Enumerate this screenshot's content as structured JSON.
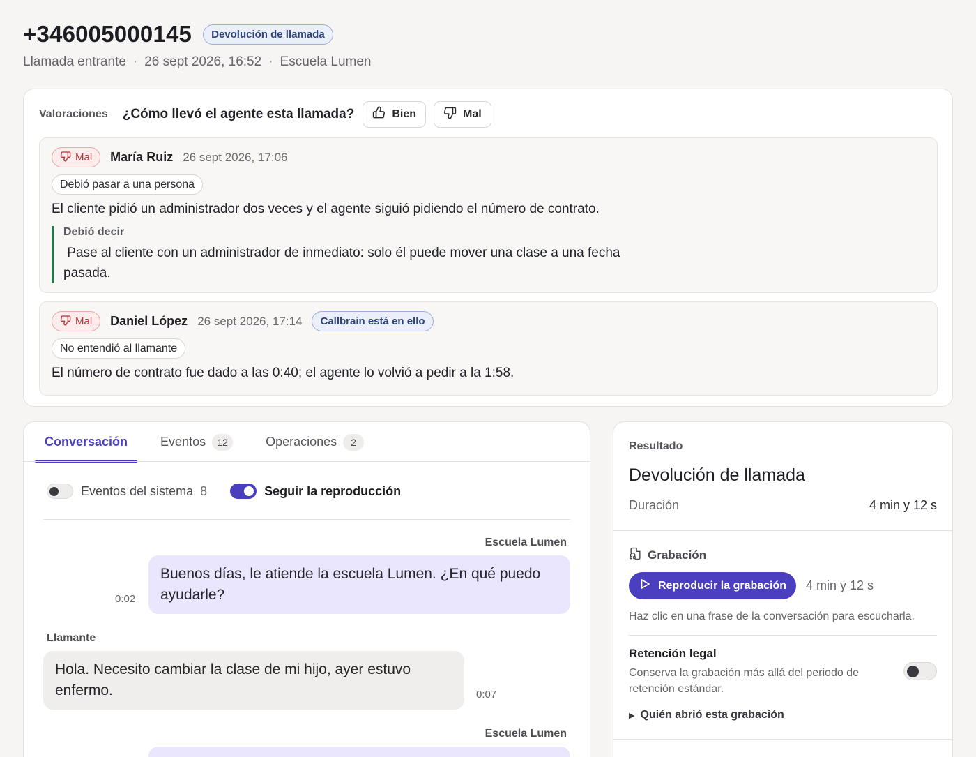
{
  "header": {
    "phone": "+346005000145",
    "badge": "Devolución de llamada",
    "meta": [
      "Llamada entrante",
      "26 sept 2026, 16:52",
      "Escuela Lumen"
    ],
    "separator": "·"
  },
  "ratings": {
    "label": "Valoraciones",
    "question": "¿Cómo llevó el agente esta llamada?",
    "good_label": "Bien",
    "bad_label": "Mal",
    "items": [
      {
        "verdict": "Mal",
        "author": "María Ruiz",
        "date": "26 sept 2026, 17:06",
        "tag": "Debió pasar a una persona",
        "comment": "El cliente pidió un administrador dos veces y el agente siguió pidiendo el número de contrato.",
        "should_say_label": "Debió decir",
        "should_say": " Pase al cliente con un administrador de inmediato: solo él puede mover una clase a una fecha pasada."
      },
      {
        "verdict": "Mal",
        "author": "Daniel López",
        "date": "26 sept 2026, 17:14",
        "status": "Callbrain está en ello",
        "tag": "No entendió al llamante",
        "comment": "El número de contrato fue dado a las 0:40; el agente lo volvió a pedir a la 1:58."
      }
    ]
  },
  "conversation": {
    "tabs": [
      {
        "label": "Conversación",
        "count": ""
      },
      {
        "label": "Eventos",
        "count": "12"
      },
      {
        "label": "Operaciones",
        "count": "2"
      }
    ],
    "system_events_label": "Eventos del sistema",
    "system_events_count": "8",
    "system_events_enabled": false,
    "follow_playback_label": "Seguir la reproducción",
    "follow_playback_enabled": true,
    "messages": [
      {
        "speaker": "Escuela Lumen",
        "time": "0:02",
        "text": "Buenos días, le atiende la escuela Lumen. ¿En qué puedo ayudarle?"
      },
      {
        "speaker": "Llamante",
        "time": "0:07",
        "text": "Hola. Necesito cambiar la clase de mi hijo, ayer estuvo enfermo."
      },
      {
        "speaker": "Escuela Lumen",
        "time": "",
        "text": ""
      }
    ]
  },
  "side": {
    "result_label": "Resultado",
    "result": "Devolución de llamada",
    "duration_label": "Duración",
    "duration": "4 min y 12 s",
    "recording_label": "Grabación",
    "play_label": "Reproducir la grabación",
    "recording_duration": "4 min y 12 s",
    "hint": "Haz clic en una frase de la conversación para escucharla.",
    "retention_title": "Retención legal",
    "retention_desc": "Conserva la grabación más allá del periodo de retención estándar.",
    "retention_enabled": false,
    "who_opened": "Quién abrió esta grabación"
  },
  "colors": {
    "accent": "#4a3fbf",
    "bad": "#b5313a",
    "quote_border": "#1f7a4a",
    "agent_bubble": "#e9e6fd",
    "caller_bubble": "#efeeec"
  }
}
